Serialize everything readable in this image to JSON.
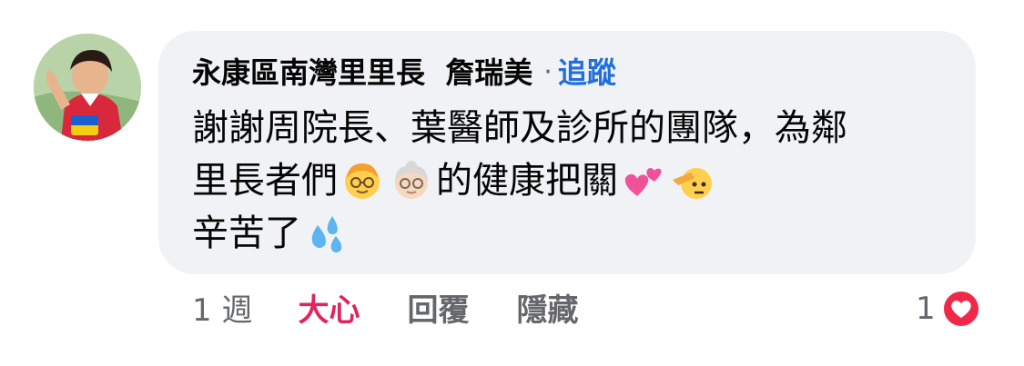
{
  "comment": {
    "author": "永康區南灣里里長  詹瑞美",
    "separator": "·",
    "follow_label": "追蹤",
    "lines": [
      "謝謝周院長、葉醫師及診所的團隊，為鄰",
      "里長者們",
      "的健康把關",
      "辛苦了"
    ],
    "emoji": {
      "older_man": "older-man-emoji",
      "older_woman": "older-woman-emoji",
      "two_hearts": "two-hearts-emoji",
      "saluting_face": "saluting-face-emoji",
      "sweat_droplets": "sweat-droplets-emoji"
    }
  },
  "actions": {
    "time": "1 週",
    "reaction_label": "大心",
    "reply_label": "回覆",
    "hide_label": "隱藏"
  },
  "reactions": {
    "count": "1",
    "icon": "love-reaction-icon"
  },
  "colors": {
    "bubble": "#f0f2f5",
    "follow": "#216fdb",
    "love": "#e0245e",
    "muted": "#65676b"
  }
}
